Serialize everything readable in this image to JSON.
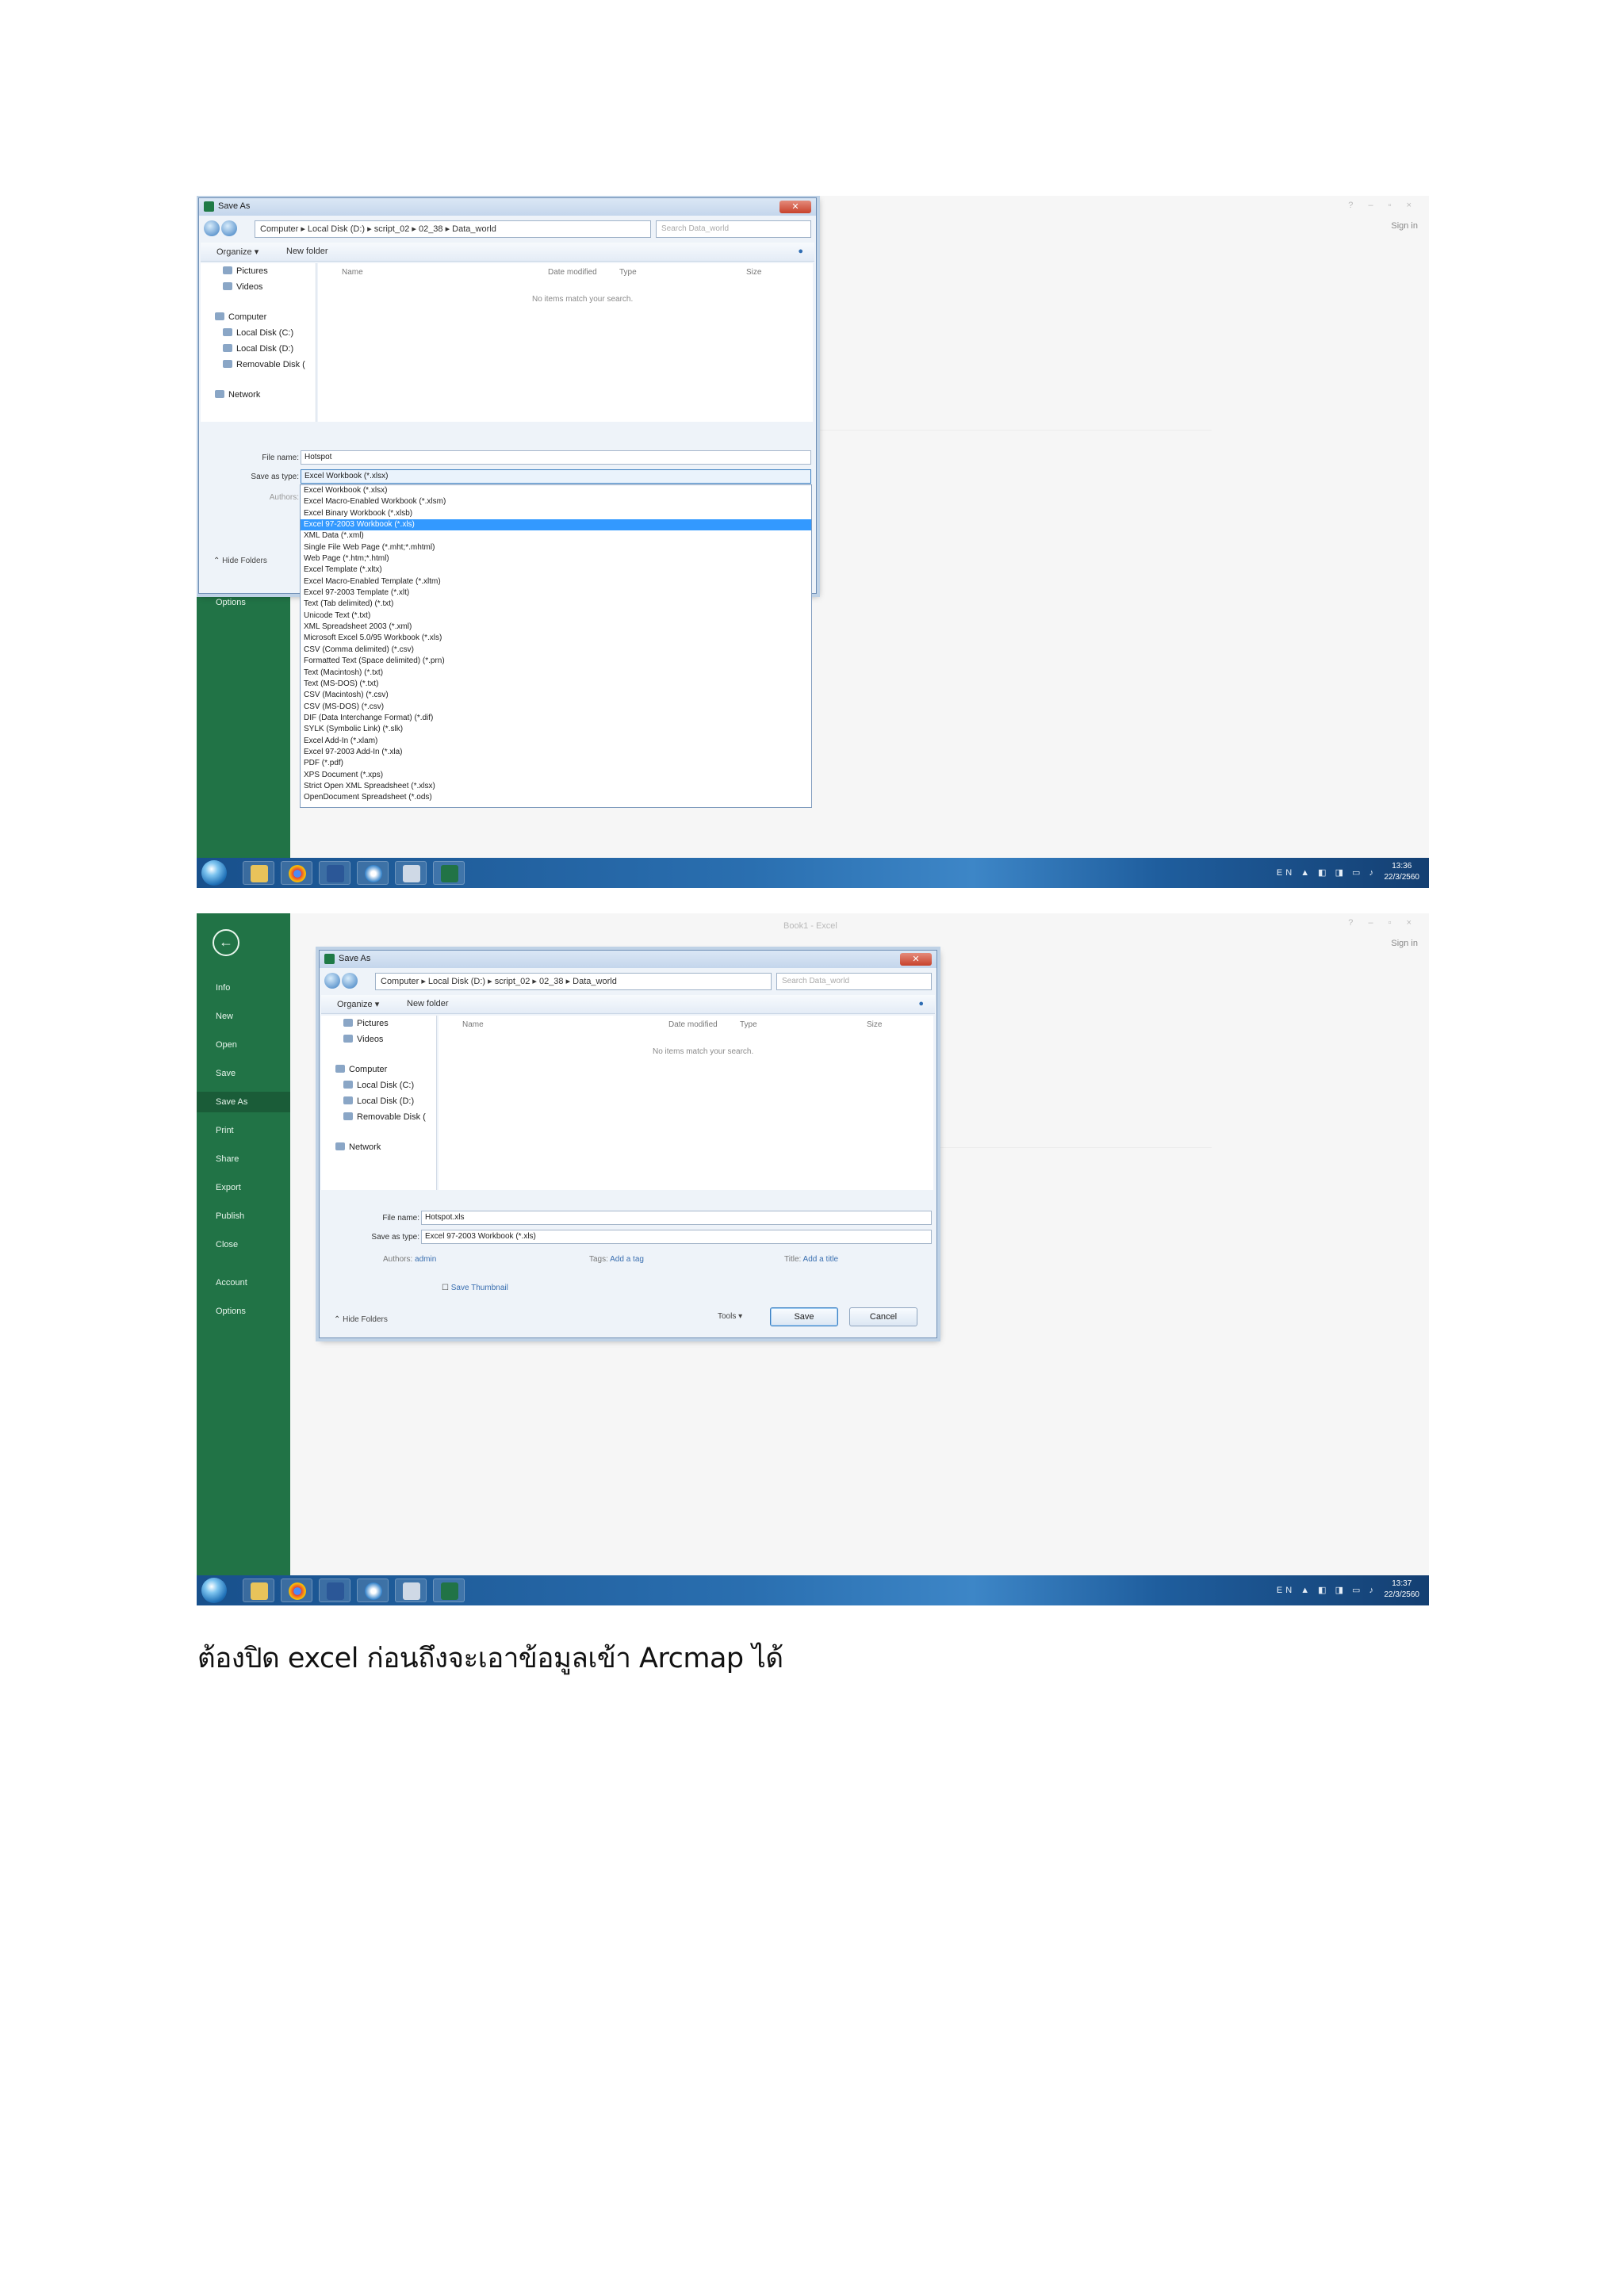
{
  "shot1": {
    "dialog_title": "Save As",
    "address_path": "Computer ▸ Local Disk (D:) ▸ script_02 ▸ 02_38 ▸ Data_world",
    "search_placeholder": "Search Data_world",
    "toolbar": {
      "organize": "Organize ▾",
      "new_folder": "New folder"
    },
    "nav_items": [
      "Pictures",
      "Videos",
      "Computer",
      "Local Disk (C:)",
      "Local Disk (D:)",
      "Removable Disk (",
      "Network"
    ],
    "columns": [
      "Name",
      "Date modified",
      "Type",
      "Size"
    ],
    "empty_message": "No items match your search.",
    "file_name_label": "File name:",
    "file_name_value": "Hotspot",
    "save_type_label": "Save as type:",
    "save_type_value": "Excel Workbook (*.xlsx)",
    "authors_label": "Authors:",
    "hide_folders": "Hide Folders",
    "excel_options": "Options",
    "file_types": [
      "Excel Workbook (*.xlsx)",
      "Excel Macro-Enabled Workbook (*.xlsm)",
      "Excel Binary Workbook (*.xlsb)",
      "Excel 97-2003 Workbook (*.xls)",
      "XML Data (*.xml)",
      "Single File Web Page (*.mht;*.mhtml)",
      "Web Page (*.htm;*.html)",
      "Excel Template (*.xltx)",
      "Excel Macro-Enabled Template (*.xltm)",
      "Excel 97-2003 Template (*.xlt)",
      "Text (Tab delimited) (*.txt)",
      "Unicode Text (*.txt)",
      "XML Spreadsheet 2003 (*.xml)",
      "Microsoft Excel 5.0/95 Workbook (*.xls)",
      "CSV (Comma delimited) (*.csv)",
      "Formatted Text (Space delimited) (*.prn)",
      "Text (Macintosh) (*.txt)",
      "Text (MS-DOS) (*.txt)",
      "CSV (Macintosh) (*.csv)",
      "CSV (MS-DOS) (*.csv)",
      "DIF (Data Interchange Format) (*.dif)",
      "SYLK (Symbolic Link) (*.slk)",
      "Excel Add-In (*.xlam)",
      "Excel 97-2003 Add-In (*.xla)",
      "PDF (*.pdf)",
      "XPS Document (*.xps)",
      "Strict Open XML Spreadsheet (*.xlsx)",
      "OpenDocument Spreadsheet (*.ods)"
    ],
    "highlighted_index": 3,
    "signin": "Sign in",
    "clock_time": "13:36",
    "clock_date": "22/3/2560"
  },
  "shot2": {
    "excel_title": "Book1 - Excel",
    "dialog_title": "Save As",
    "address_path": "Computer ▸ Local Disk (D:) ▸ script_02 ▸ 02_38 ▸ Data_world",
    "search_placeholder": "Search Data_world",
    "toolbar": {
      "organize": "Organize ▾",
      "new_folder": "New folder"
    },
    "nav_items": [
      "Pictures",
      "Videos",
      "Computer",
      "Local Disk (C:)",
      "Local Disk (D:)",
      "Removable Disk (",
      "Network"
    ],
    "columns": [
      "Name",
      "Date modified",
      "Type",
      "Size"
    ],
    "empty_message": "No items match your search.",
    "file_name_label": "File name:",
    "file_name_value": "Hotspot.xls",
    "save_type_label": "Save as type:",
    "save_type_value": "Excel 97-2003 Workbook (*.xls)",
    "authors_label": "Authors:",
    "authors_value": "admin",
    "tags_label": "Tags:",
    "tags_value": "Add a tag",
    "title_label": "Title:",
    "title_value": "Add a title",
    "save_thumbnail": "Save Thumbnail",
    "hide_folders": "Hide Folders",
    "tools": "Tools",
    "save_button": "Save",
    "cancel_button": "Cancel",
    "backstage_menu": [
      "Info",
      "New",
      "Open",
      "Save",
      "Save As",
      "Print",
      "Share",
      "Export",
      "Publish",
      "Close",
      "Account",
      "Options"
    ],
    "signin": "Sign in",
    "clock_time": "13:37",
    "clock_date": "22/3/2560"
  },
  "caption": "ต้องปิด excel ก่อนถึงจะเอาข้อมูลเข้า Arcmap ได้",
  "colors": {
    "excel_green": "#217346",
    "taskbar_blue": "#2a6fb0",
    "highlight": "#3399ff"
  }
}
